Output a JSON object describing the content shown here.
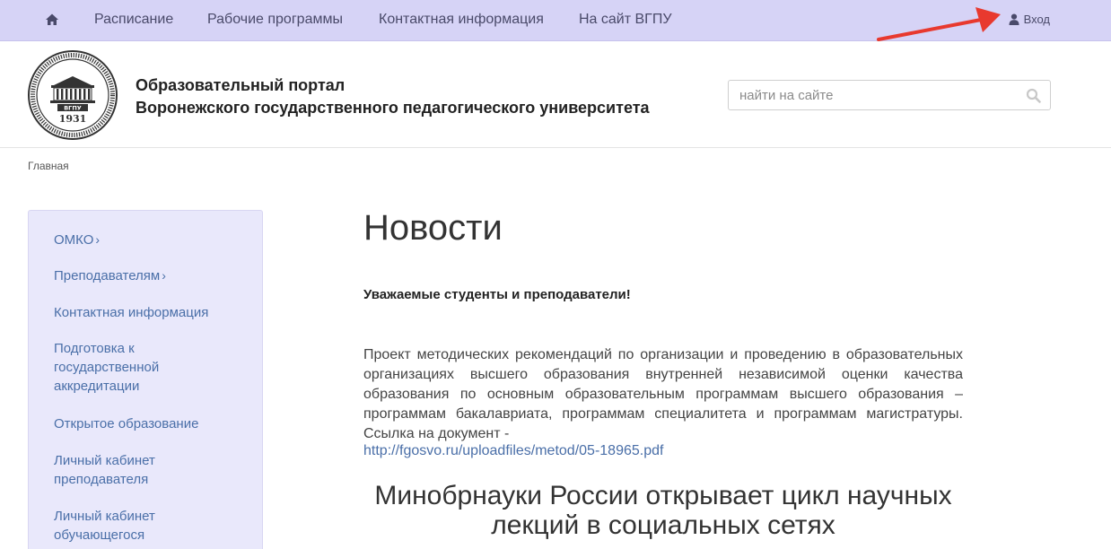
{
  "topnav": {
    "home_icon": "home-icon",
    "links": [
      "Расписание",
      "Рабочие программы",
      "Контактная информация",
      "На сайт ВГПУ"
    ],
    "login_label": "Вход",
    "login_icon": "user-icon",
    "annotation_color": "#e8392e"
  },
  "header": {
    "logo_year": "1931",
    "logo_abbr": "ВГПУ",
    "title_line1": "Образовательный портал",
    "title_line2": "Воронежского государственного педагогического университета",
    "search_placeholder": "найти на сайте"
  },
  "breadcrumb": "Главная",
  "sidebar": {
    "items": [
      {
        "label": "ОМКО",
        "chevron": "›"
      },
      {
        "label": "Преподавателям",
        "chevron": "›"
      },
      {
        "label": "Контактная информация"
      },
      {
        "label": "Подготовка к государственной аккредитации"
      },
      {
        "label": "Открытое образование"
      },
      {
        "label": "Личный кабинет преподавателя"
      },
      {
        "label": "Личный кабинет обучающегося"
      }
    ]
  },
  "main": {
    "title": "Новости",
    "greeting": "Уважаемые студенты и преподаватели!",
    "paragraph": "Проект методических рекомендаций по организации и проведению в образовательных организациях высшего образования внутренней независимой оценки качества образования по основным образовательным программам высшего образования – программам бакалавриата, программам специалитета и программам магистратуры. Ссылка на документ -",
    "doc_link": "http://fgosvo.ru/uploadfiles/metod/05-18965.pdf",
    "news_headline": "Минобрнауки России открывает цикл научных лекций в социальных сетях"
  },
  "colors": {
    "nav_bg": "#d6d3f6",
    "sidebar_bg": "#e9e8fb",
    "link": "#4a6fa8"
  }
}
